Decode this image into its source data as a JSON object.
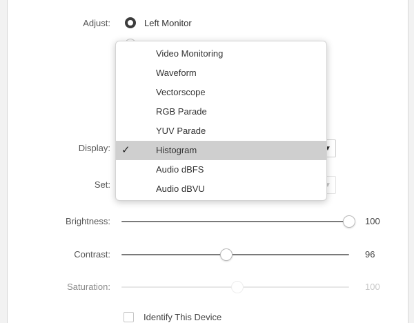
{
  "adjust": {
    "label": "Adjust:",
    "options": [
      "Left Monitor"
    ],
    "selected": "Left Monitor"
  },
  "display": {
    "label": "Display:"
  },
  "set": {
    "label": "Set:"
  },
  "menu": {
    "items": [
      "Video Monitoring",
      "Waveform",
      "Vectorscope",
      "RGB Parade",
      "YUV Parade",
      "Histogram",
      "Audio dBFS",
      "Audio dBVU"
    ],
    "selected": "Histogram"
  },
  "sliders": [
    {
      "label": "Brightness:",
      "value": "100",
      "level": 1.0,
      "enabled": true
    },
    {
      "label": "Contrast:",
      "value": "96",
      "level": 0.46,
      "enabled": true
    },
    {
      "label": "Saturation:",
      "value": "100",
      "level": 0.51,
      "enabled": false
    }
  ],
  "identify": {
    "label": "Identify This Device",
    "checked": false
  }
}
